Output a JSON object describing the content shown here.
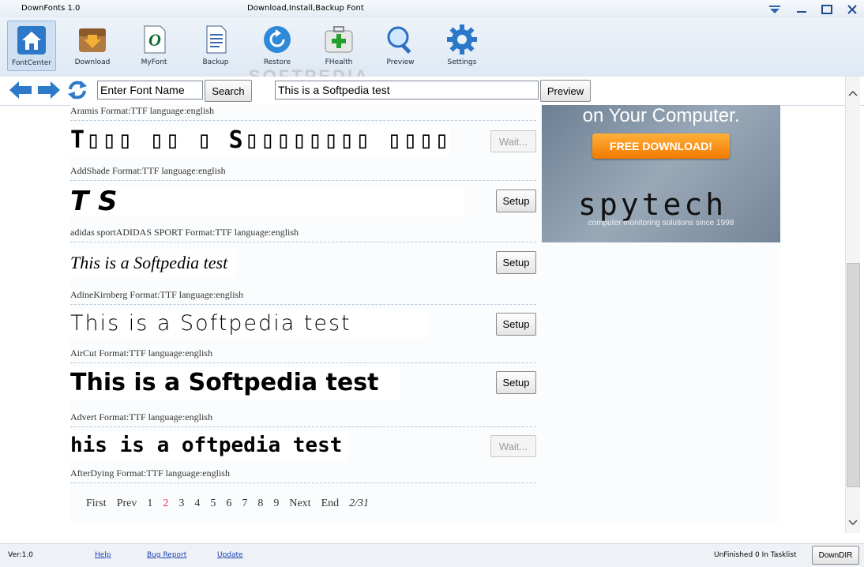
{
  "window": {
    "app_title": "DownFonts 1.0",
    "title": "Download,Install,Backup Font"
  },
  "toolbar": {
    "items": [
      {
        "label": "FontCenter",
        "icon": "house-icon"
      },
      {
        "label": "Download",
        "icon": "download-box-icon"
      },
      {
        "label": "MyFont",
        "icon": "font-file-icon"
      },
      {
        "label": "Backup",
        "icon": "document-icon"
      },
      {
        "label": "Restore",
        "icon": "restore-icon"
      },
      {
        "label": "FHealth",
        "icon": "health-kit-icon"
      },
      {
        "label": "Preview",
        "icon": "magnifier-icon"
      },
      {
        "label": "Settings",
        "icon": "gear-icon"
      }
    ],
    "active": "FontCenter"
  },
  "watermark": "SOFTPEDIA",
  "nav": {
    "search_value": "Enter Font Name",
    "search_button": "Search",
    "preview_text": "This is a Softpedia test",
    "preview_button": "Preview"
  },
  "fonts": [
    {
      "name": "Aramis",
      "format": "TTF",
      "language": "english",
      "meta": "Aramis Format:TTF language:english",
      "preview": "",
      "action": ""
    },
    {
      "name": "AddShade",
      "format": "TTF",
      "language": "english",
      "meta": "AddShade Format:TTF language:english",
      "preview": "T▯▯▯ ▯▯ ▯ S▯▯▯▯▯▯▯▯ ▯▯▯▯",
      "action": "Wait..."
    },
    {
      "name": "adidas sportADIDAS SPORT",
      "format": "TTF",
      "language": "english",
      "meta": "adidas sportADIDAS SPORT Format:TTF language:english",
      "preview": "T                                              S",
      "action": "Setup"
    },
    {
      "name": "AdineKirnberg",
      "format": "TTF",
      "language": "english",
      "meta": "AdineKirnberg Format:TTF language:english",
      "preview": "This is a Softpedia test",
      "action": "Setup"
    },
    {
      "name": "AirCut",
      "format": "TTF",
      "language": "english",
      "meta": "AirCut Format:TTF language:english",
      "preview": "This is a Softpedia test",
      "action": "Setup"
    },
    {
      "name": "Advert",
      "format": "TTF",
      "language": "english",
      "meta": "Advert Format:TTF language:english",
      "preview": "This is a Softpedia test",
      "action": "Setup"
    },
    {
      "name": "AfterDying",
      "format": "TTF",
      "language": "english",
      "meta": "AfterDying Format:TTF language:english",
      "preview": "his is a oftpedia test",
      "action": "Wait..."
    }
  ],
  "pager": {
    "first": "First",
    "prev": "Prev",
    "pages": [
      "1",
      "2",
      "3",
      "4",
      "5",
      "6",
      "7",
      "8",
      "9"
    ],
    "current": "2",
    "next": "Next",
    "end": "End",
    "position": "2/31"
  },
  "ad": {
    "headline": "on Your Computer.",
    "button": "FREE DOWNLOAD!",
    "logo": "spytech",
    "tagline": "computer monitoring solutions since 1998"
  },
  "status": {
    "version": "Ver:1.0",
    "help": "Help",
    "bug_report": "Bug Report",
    "update": "Update",
    "tasklist": "UnFinished 0 In Tasklist",
    "downdir": "DownDIR"
  }
}
